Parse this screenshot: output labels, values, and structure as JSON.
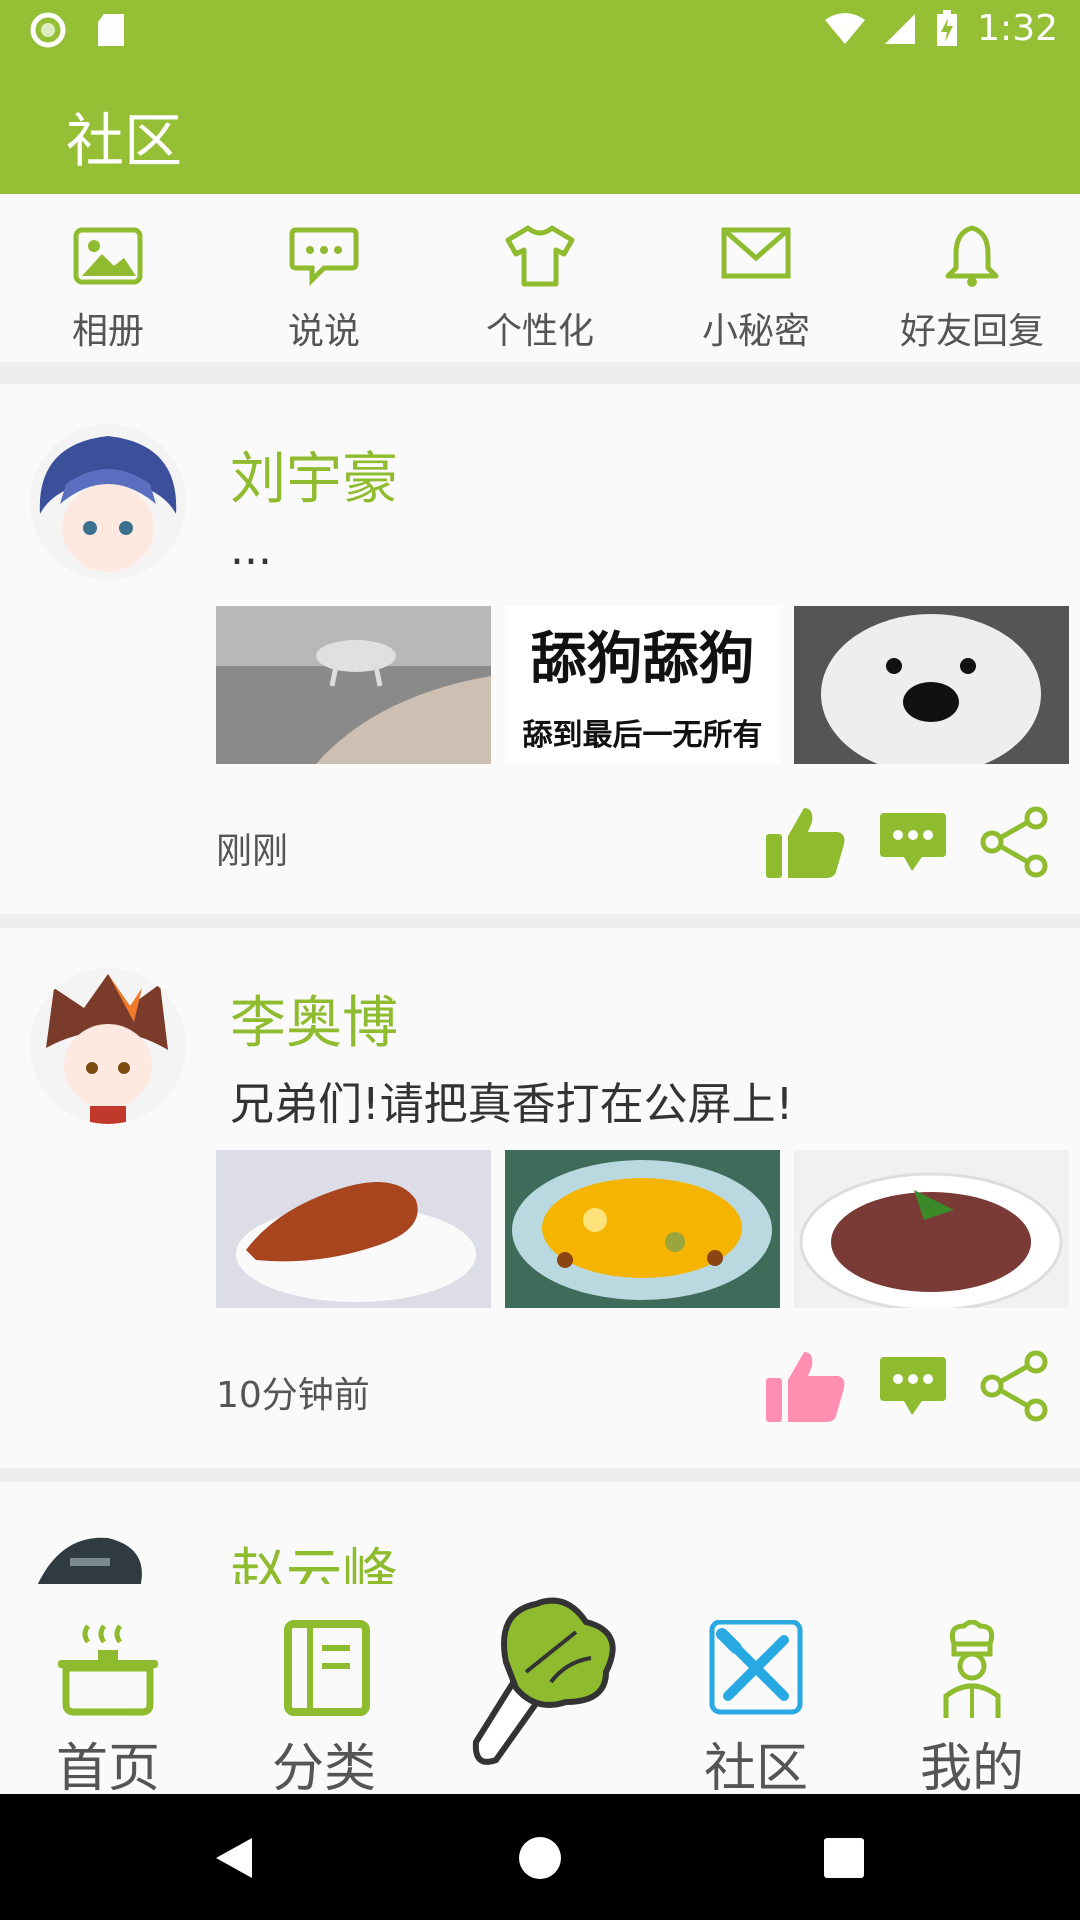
{
  "status_bar": {
    "time": "1:32"
  },
  "app_bar": {
    "title": "社区"
  },
  "quick_menu": [
    {
      "label": "相册",
      "icon": "photo-icon"
    },
    {
      "label": "说说",
      "icon": "chat-bubble-icon"
    },
    {
      "label": "个性化",
      "icon": "tshirt-icon"
    },
    {
      "label": "小秘密",
      "icon": "envelope-icon"
    },
    {
      "label": "好友回复",
      "icon": "bell-icon"
    }
  ],
  "posts": [
    {
      "user": "刘宇豪",
      "text": "...",
      "time": "刚刚",
      "liked": false,
      "image_captions": [
        "舔狗舔狗",
        "舔到最后一无所有"
      ]
    },
    {
      "user": "李奥博",
      "text": "兄弟们!请把真香打在公屏上!",
      "time": "10分钟前",
      "liked": true
    },
    {
      "user": "赵云峰"
    }
  ],
  "bottom_nav": [
    {
      "label": "首页",
      "icon": "pot-icon"
    },
    {
      "label": "分类",
      "icon": "notebook-icon"
    },
    {
      "label": "社区",
      "icon": "fork-knife-icon",
      "active": true
    },
    {
      "label": "我的",
      "icon": "chef-icon"
    }
  ],
  "colors": {
    "primary": "#95bf35",
    "liked": "#ff8fb0",
    "community_icon_accent": "#29a9e1"
  }
}
